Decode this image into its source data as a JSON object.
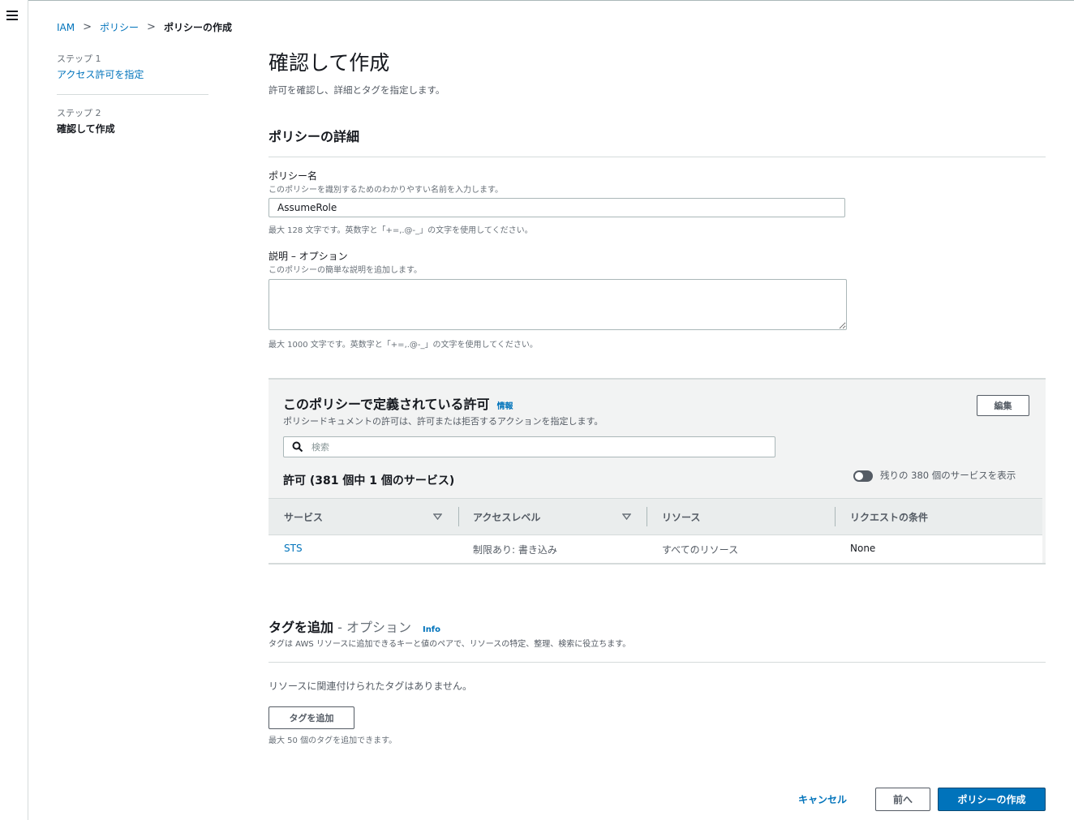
{
  "breadcrumb": {
    "items": [
      "IAM",
      "ポリシー"
    ],
    "current": "ポリシーの作成"
  },
  "steps": {
    "step1_label": "ステップ 1",
    "step1_title": "アクセス許可を指定",
    "step2_label": "ステップ 2",
    "step2_title": "確認して作成"
  },
  "page": {
    "title": "確認して作成",
    "subtitle": "許可を確認し、詳細とタグを指定します。"
  },
  "details": {
    "section_title": "ポリシーの詳細",
    "name_label": "ポリシー名",
    "name_desc": "このポリシーを識別するためのわかりやすい名前を入力します。",
    "name_value": "AssumeRole",
    "name_constraint": "最大 128 文字です。英数字と「+=,.@-_」の文字を使用してください。",
    "desc_label": "説明 – オプション",
    "desc_desc": "このポリシーの簡単な説明を追加します。",
    "desc_value": "",
    "desc_constraint": "最大 1000 文字です。英数字と「+=,.@-_」の文字を使用してください。"
  },
  "permissions": {
    "title": "このポリシーで定義されている許可",
    "info": "情報",
    "description": "ポリシードキュメントの許可は、許可または拒否するアクションを指定します。",
    "edit_label": "編集",
    "search_placeholder": "検索",
    "count_label": "許可 (381 個中 1 個のサービス)",
    "toggle_label": "残りの 380 個のサービスを表示",
    "toggle_on": false,
    "columns": [
      "サービス",
      "アクセスレベル",
      "リソース",
      "リクエストの条件"
    ],
    "rows": [
      {
        "service": "STS",
        "access_level": "制限あり: 書き込み",
        "resource": "すべてのリソース",
        "condition": "None"
      }
    ]
  },
  "tags": {
    "title": "タグを追加",
    "optional": " - オプション",
    "info": "Info",
    "description": "タグは AWS リソースに追加できるキーと値のペアで、リソースの特定、整理、検索に役立ちます。",
    "empty_text": "リソースに関連付けられたタグはありません。",
    "add_button": "タグを追加",
    "limit_text": "最大 50 個のタグを追加できます。"
  },
  "footer": {
    "cancel": "キャンセル",
    "previous": "前へ",
    "create": "ポリシーの作成"
  },
  "colors": {
    "link": "#0073bb",
    "primary_button": "#0073bb",
    "panel_bg": "#f2f3f3"
  }
}
